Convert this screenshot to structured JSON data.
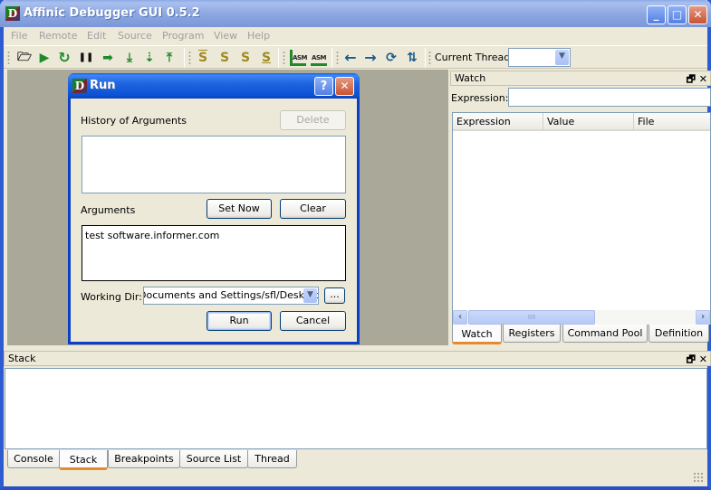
{
  "app": {
    "title": "Affinic Debugger GUI 0.5.2",
    "icon": "D"
  },
  "window_controls": {
    "minimize": "_",
    "maximize": "□",
    "close": "✕"
  },
  "menu": [
    "File",
    "Remote",
    "Edit",
    "Source",
    "Program",
    "View",
    "Help"
  ],
  "toolbar": {
    "icons": [
      {
        "name": "open-folder-icon",
        "glyph": "🗁"
      },
      {
        "name": "run-icon",
        "glyph": "▶"
      },
      {
        "name": "restart-icon",
        "glyph": "↻"
      },
      {
        "name": "pause-icon",
        "glyph": "❚❚"
      },
      {
        "name": "continue-icon",
        "glyph": "➡"
      },
      {
        "name": "step-into-icon",
        "glyph": "⤓"
      },
      {
        "name": "step-over-icon",
        "glyph": "⇣"
      },
      {
        "name": "step-out-icon",
        "glyph": "⤒"
      },
      {
        "name": "stack-top-icon",
        "glyph": "S"
      },
      {
        "name": "stack-up-icon",
        "glyph": "S"
      },
      {
        "name": "stack-down-icon",
        "glyph": "S"
      },
      {
        "name": "stack-bottom-icon",
        "glyph": "S"
      },
      {
        "name": "asm-step-into-icon",
        "glyph": "ASM"
      },
      {
        "name": "asm-step-over-icon",
        "glyph": "ASM"
      },
      {
        "name": "back-icon",
        "glyph": "←"
      },
      {
        "name": "forward-icon",
        "glyph": "→"
      },
      {
        "name": "run-to-cursor-icon",
        "glyph": "⟳"
      },
      {
        "name": "jump-icon",
        "glyph": "⇅"
      }
    ],
    "current_thread_label": "Current Thread:",
    "current_thread_value": ""
  },
  "dialog": {
    "title": "Run",
    "help": "?",
    "close": "✕",
    "history_label": "History of Arguments",
    "delete_label": "Delete",
    "history_items": [],
    "arguments_label": "Arguments",
    "set_now_label": "Set Now",
    "clear_label": "Clear",
    "arguments_value": "test software.informer.com",
    "working_dir_label": "Working Dir:",
    "working_dir_value": "Documents and Settings/sfl/Desktop",
    "browse_label": "...",
    "run_label": "Run",
    "cancel_label": "Cancel"
  },
  "watch": {
    "title": "Watch",
    "float_icon": "🗗",
    "close_icon": "✕",
    "expression_label": "Expression:",
    "expression_value": "",
    "columns": [
      "Expression",
      "Value",
      "File"
    ],
    "rows": [],
    "scroll_left": "‹",
    "scroll_right": "›",
    "scroll_thumb": "IIII",
    "tabs": [
      "Watch",
      "Registers",
      "Command Pool",
      "Definition"
    ],
    "active_tab": "Watch"
  },
  "stack": {
    "title": "Stack",
    "float_icon": "🗗",
    "close_icon": "✕",
    "rows": [],
    "tabs": [
      "Console",
      "Stack",
      "Breakpoints",
      "Source List",
      "Thread"
    ],
    "active_tab": "Stack"
  }
}
